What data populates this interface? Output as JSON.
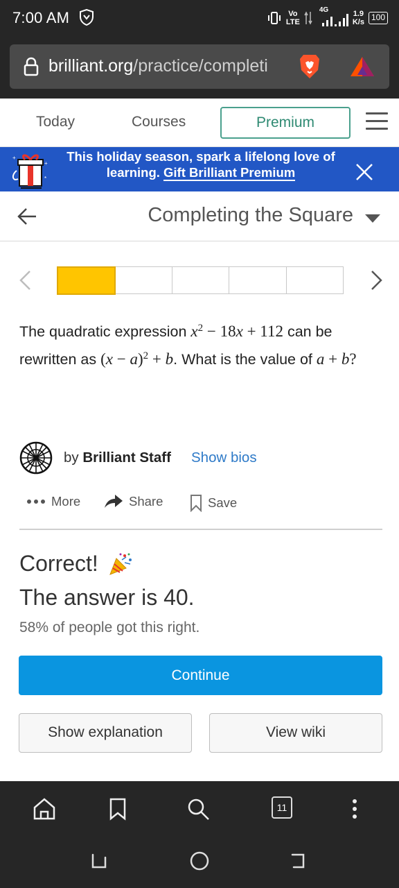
{
  "status_bar": {
    "time": "7:00 AM",
    "network_volte_top": "Vo",
    "network_volte_bottom": "LTE",
    "network_type": "4G",
    "speed_value": "1.9",
    "speed_unit": "K/s",
    "battery": "100"
  },
  "browser": {
    "url_domain": "brilliant.org",
    "url_path": "/practice/completi",
    "tab_count": "11"
  },
  "nav": {
    "today": "Today",
    "courses": "Courses",
    "premium": "Premium"
  },
  "banner": {
    "text_prefix": "This holiday season, spark a lifelong love of learning.",
    "link_text": "Gift Brilliant Premium"
  },
  "course": {
    "title": "Completing the Square"
  },
  "progress": {
    "segments_total": 5,
    "segments_completed": 1
  },
  "problem": {
    "text_1": "The quadratic expression",
    "expr_1": "x² − 18x + 112",
    "text_2": "can be rewritten as",
    "expr_2": "(x − a)² + b",
    "text_3": ". What is the value of",
    "expr_3": "a + b",
    "text_4": "?"
  },
  "author": {
    "by": "by",
    "name": "Brilliant Staff",
    "bios_link": "Show bios"
  },
  "actions": {
    "more": "More",
    "share": "Share",
    "save": "Save"
  },
  "result": {
    "correct": "Correct!",
    "answer": "The answer is 40.",
    "stat": "58% of people got this right."
  },
  "buttons": {
    "continue": "Continue",
    "show_explanation": "Show explanation",
    "view_wiki": "View wiki"
  },
  "colors": {
    "progress_fill": "#ffc500",
    "continue_bg": "#0a95e0",
    "banner_bg": "#2257c5",
    "premium_border": "#4aa08d",
    "link": "#2e7ac8"
  },
  "icons": [
    "shield-icon",
    "lock-icon",
    "brave-lion-icon",
    "bat-triangle-icon",
    "menu-icon",
    "gift-icon",
    "close-icon",
    "back-arrow-icon",
    "caret-down-icon",
    "chevron-left-icon",
    "chevron-right-icon",
    "brilliant-logo-icon",
    "more-dots-icon",
    "share-icon",
    "bookmark-icon",
    "party-popper-icon",
    "home-icon",
    "bookmarks-icon",
    "search-icon",
    "menu-dots-icon",
    "recents-icon",
    "home-circle-icon",
    "back-nav-icon"
  ]
}
